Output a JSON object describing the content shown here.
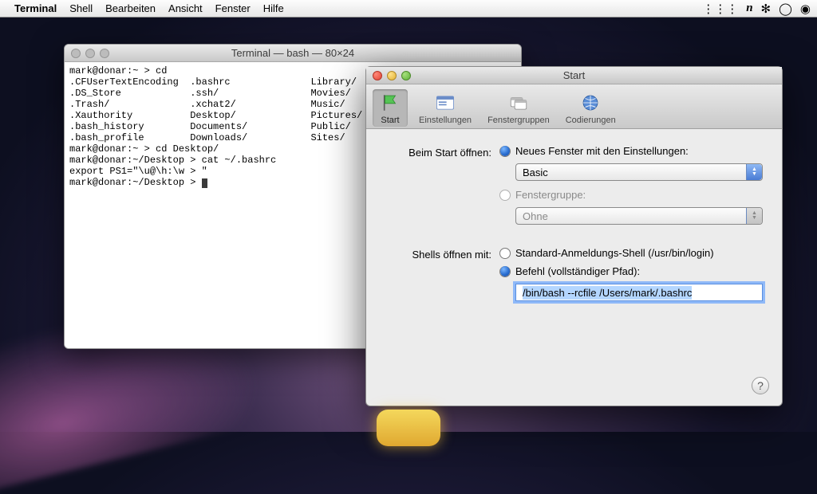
{
  "menubar": {
    "app": "Terminal",
    "items": [
      "Shell",
      "Bearbeiten",
      "Ansicht",
      "Fenster",
      "Hilfe"
    ]
  },
  "terminal": {
    "title": "Terminal — bash — 80×24",
    "content": "mark@donar:~ > cd\n.CFUserTextEncoding  .bashrc              Library/\n.DS_Store            .ssh/                Movies/\n.Trash/              .xchat2/             Music/\n.Xauthority          Desktop/             Pictures/\n.bash_history        Documents/           Public/\n.bash_profile        Downloads/           Sites/\nmark@donar:~ > cd Desktop/\nmark@donar:~/Desktop > cat ~/.bashrc\nexport PS1=\"\\u@\\h:\\w > \"\nmark@donar:~/Desktop > "
  },
  "prefs": {
    "title": "Start",
    "toolbar": {
      "start": "Start",
      "einstellungen": "Einstellungen",
      "fenstergruppen": "Fenstergruppen",
      "codierungen": "Codierungen"
    },
    "start_label": "Beim Start öffnen:",
    "radio_new_window": "Neues Fenster mit den Einstellungen:",
    "popup_settings_value": "Basic",
    "radio_fenstergruppe": "Fenstergruppe:",
    "popup_group_value": "Ohne",
    "shells_label": "Shells öffnen mit:",
    "radio_login_shell": "Standard-Anmeldungs-Shell (/usr/bin/login)",
    "radio_command": "Befehl (vollständiger Pfad):",
    "command_value": "/bin/bash --rcfile /Users/mark/.bashrc"
  }
}
